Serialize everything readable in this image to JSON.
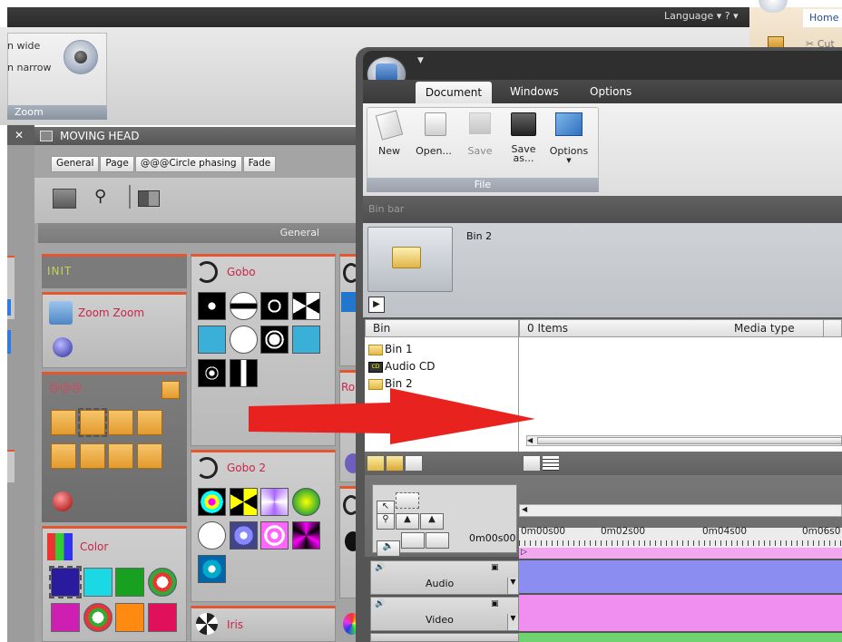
{
  "topbar": {
    "language": "Language ▾ ? ▾"
  },
  "zoom_panel": {
    "line1": "n wide",
    "line2": "n narrow",
    "footer": "Zoom"
  },
  "home_ribbon": {
    "home_tab": "Home",
    "cut": "✂ Cut"
  },
  "moving_head": {
    "close": "✕",
    "title": "MOVING HEAD",
    "tabs": [
      "General",
      "Page",
      "@@@Circle phasing",
      "Fade"
    ],
    "general_label": "General",
    "cards": {
      "init": "INIT",
      "zoom": "Zoom Zoom",
      "circle": "@@@",
      "color": "Color",
      "gobo": "Gobo",
      "gobo2": "Gobo 2",
      "iris": "Iris",
      "r2": "Ro"
    }
  },
  "app": {
    "ribbon_tabs": [
      "Document",
      "Windows",
      "Options"
    ],
    "file_group": {
      "buttons": [
        {
          "label": "New",
          "icon": "new-document-icon"
        },
        {
          "label": "Open...",
          "icon": "open-folder-icon"
        },
        {
          "label": "Save",
          "icon": "save-disk-icon"
        },
        {
          "label": "Save as...",
          "icon": "save-as-icon"
        },
        {
          "label": "Options",
          "icon": "options-icon"
        }
      ],
      "footer": "File"
    },
    "bin_bar_label": "Bin bar",
    "bin_thumb_label": "Bin 2",
    "tree_header": "Bin",
    "list_header": {
      "items": "0 Items",
      "media_type": "Media type"
    },
    "tree_nodes": [
      {
        "label": "Bin 1",
        "icon": "folder-icon"
      },
      {
        "label": "Audio CD",
        "icon": "cd-icon"
      },
      {
        "label": "Bin 2",
        "icon": "folder-icon"
      }
    ],
    "timeline": {
      "timecode": "0m00s00",
      "ruler": [
        "0m00s00",
        "0m02s00",
        "0m04s00",
        "0m06s0"
      ],
      "tracks": [
        "Audio",
        "Video"
      ]
    }
  }
}
